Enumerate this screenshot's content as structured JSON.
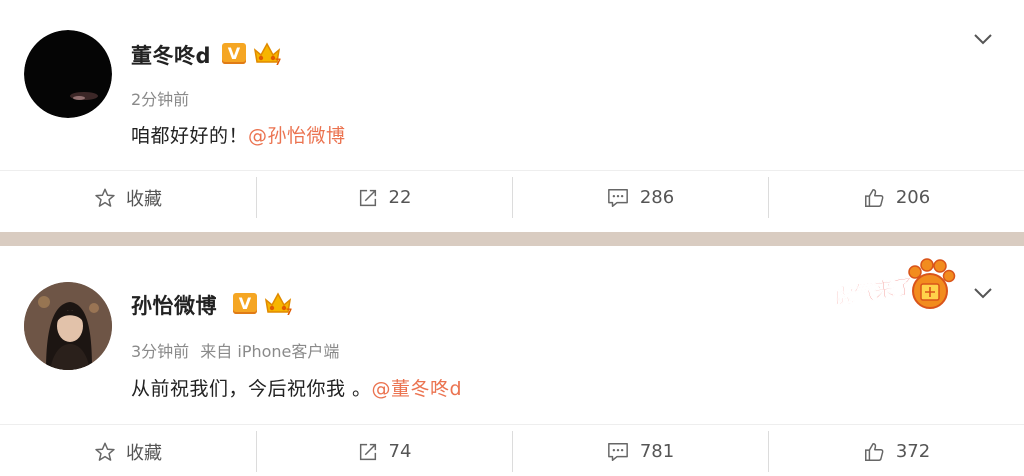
{
  "posts": [
    {
      "username": "董冬咚d",
      "verified_badge": "V",
      "time": "2分钟前",
      "source": "",
      "text": "咱都好好的！",
      "mention": "@孙怡微博",
      "actions": {
        "favorite_label": "收藏",
        "repost_count": "22",
        "comment_count": "286",
        "like_count": "206"
      }
    },
    {
      "username": "孙怡微博",
      "verified_badge": "V",
      "time": "3分钟前",
      "source": "来自 iPhone客户端",
      "text": "从前祝我们，今后祝你我 。",
      "mention": "@董冬咚d",
      "actions": {
        "favorite_label": "收藏",
        "repost_count": "74",
        "comment_count": "781",
        "like_count": "372"
      }
    }
  ],
  "stamp": {
    "text": "虎气来了",
    "icon": "tiger-paw-icon"
  },
  "icons": {
    "favorite": "star-outline-icon",
    "repost": "share-arrow-icon",
    "comment": "comment-bubble-icon",
    "like": "thumbs-up-icon",
    "menu": "chevron-down-icon"
  },
  "colors": {
    "mention": "#eb7350",
    "verified": "#f5a623",
    "divider_band": "#d9ccc1",
    "meta_text": "#8a8a8a"
  }
}
